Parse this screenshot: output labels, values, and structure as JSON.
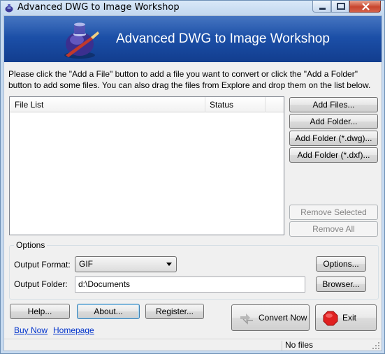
{
  "window": {
    "title": "Advanced DWG to Image Workshop"
  },
  "banner": {
    "title": "Advanced DWG to Image Workshop"
  },
  "instructions": "Please click the \"Add a File\" button to add a file you want to convert or click the \"Add a Folder\" button to add some files. You can also drag the files from Explore and drop them on the list below.",
  "file_list": {
    "columns": [
      "File List",
      "Status"
    ],
    "rows": []
  },
  "side_buttons": {
    "add_files": "Add Files...",
    "add_folder": "Add Folder...",
    "add_folder_dwg": "Add Folder (*.dwg)...",
    "add_folder_dxf": "Add Folder (*.dxf)...",
    "remove_selected": "Remove Selected",
    "remove_all": "Remove All"
  },
  "options": {
    "legend": "Options",
    "output_format_label": "Output Format:",
    "output_format_value": "GIF",
    "output_folder_label": "Output Folder:",
    "output_folder_value": "d:\\Documents",
    "options_button": "Options...",
    "browse_button": "Browser..."
  },
  "bottom_buttons": {
    "help": "Help...",
    "about": "About...",
    "register": "Register...",
    "convert_now": "Convert Now",
    "exit": "Exit"
  },
  "links": {
    "buy_now": "Buy Now",
    "homepage": "Homepage"
  },
  "status_bar": {
    "text": "No files"
  },
  "icons": {
    "title": "app-logo-icon",
    "banner": "ink-bottle-pen-icon",
    "convert": "convert-arrows-icon",
    "exit": "stop-sign-icon"
  },
  "colors": {
    "banner": "#1b4ea6",
    "link": "#0033cc",
    "exit_icon": "#e02020"
  }
}
